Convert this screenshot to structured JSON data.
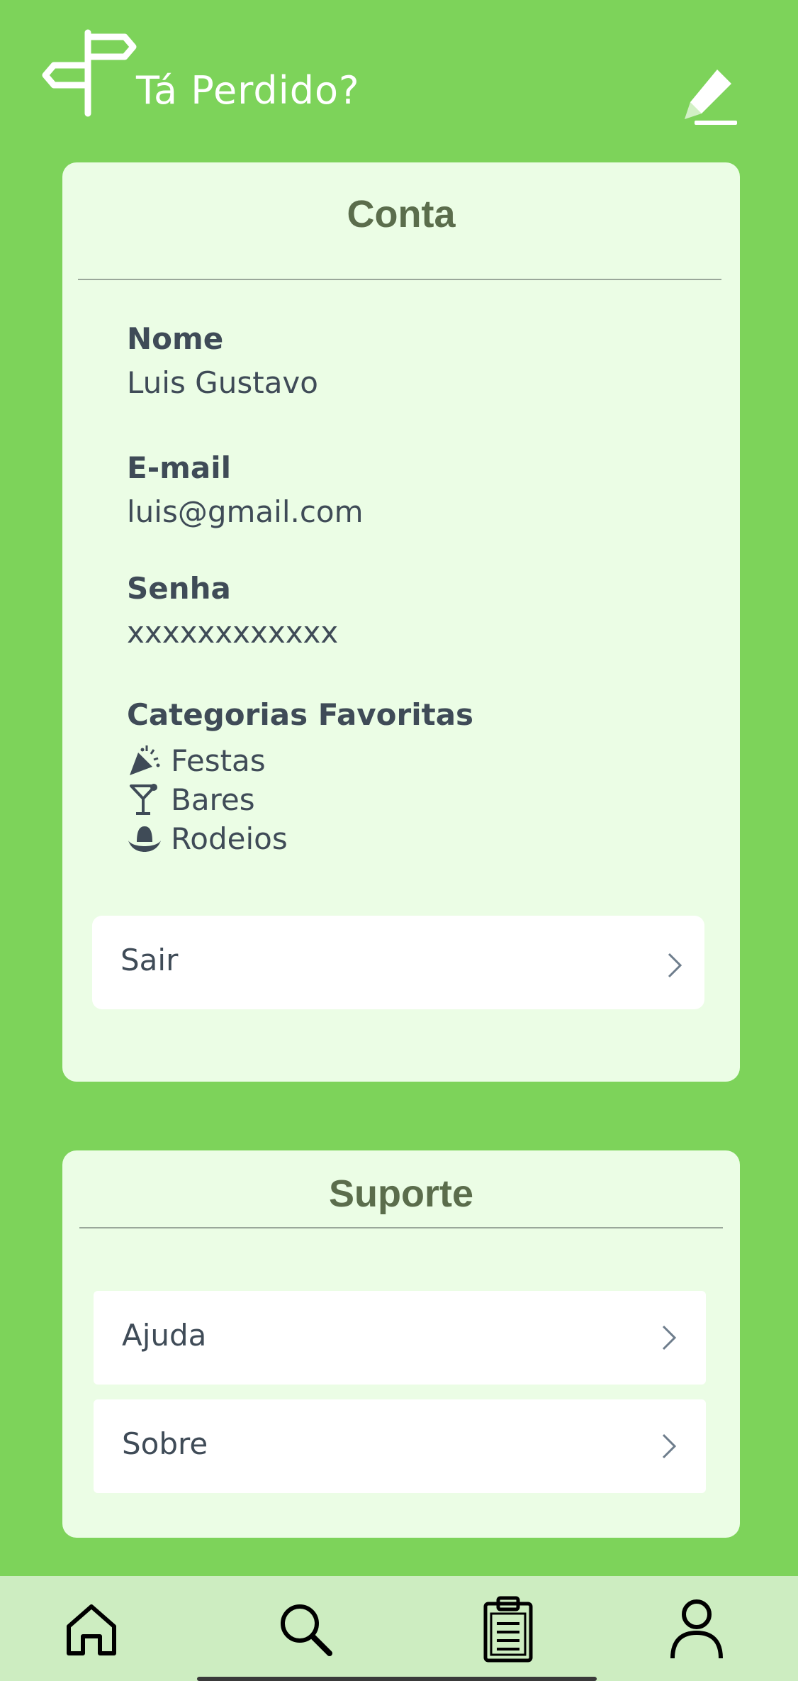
{
  "header": {
    "app_title": "Tá Perdido?",
    "logo_icon": "signpost-icon",
    "edit_icon": "pencil-icon"
  },
  "account": {
    "title": "Conta",
    "name_label": "Nome",
    "name_value": "Luis Gustavo",
    "email_label": "E-mail",
    "email_value": "luis@gmail.com",
    "password_label": "Senha",
    "password_value": "xxxxxxxxxxxx",
    "categories_label": "Categorias Favoritas",
    "categories": [
      {
        "icon": "party-popper-icon",
        "label": "Festas"
      },
      {
        "icon": "cocktail-icon",
        "label": "Bares"
      },
      {
        "icon": "cowboy-hat-icon",
        "label": "Rodeios"
      }
    ],
    "logout_label": "Sair"
  },
  "support": {
    "title": "Suporte",
    "items": [
      {
        "label": "Ajuda"
      },
      {
        "label": "Sobre"
      }
    ]
  },
  "bottom_nav": {
    "items": [
      {
        "icon": "home-icon"
      },
      {
        "icon": "search-icon"
      },
      {
        "icon": "clipboard-icon"
      },
      {
        "icon": "profile-icon"
      }
    ]
  },
  "colors": {
    "background": "#7dd35a",
    "card": "#ebfde5",
    "title_text": "#5b6d4c",
    "body_text": "#3f4b57",
    "nav_bg": "#cdedc1"
  }
}
